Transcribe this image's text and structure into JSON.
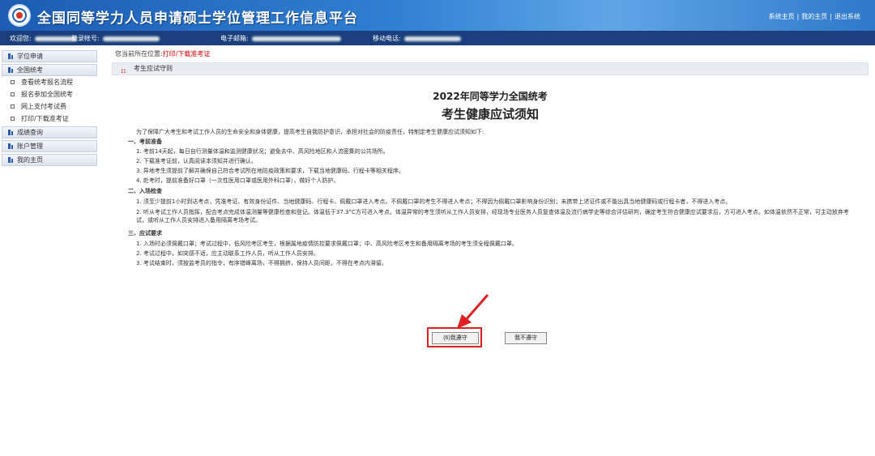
{
  "header": {
    "title": "全国同等学力人员申请硕士学位管理工作信息平台",
    "links": [
      "系统主页",
      "我的主页",
      "退出系统"
    ],
    "separator": "|"
  },
  "userbar": {
    "welcome_label": "欢迎您:",
    "account_label": "登录帐号:",
    "email_label": "电子邮箱:",
    "phone_label": "移动电话:"
  },
  "sidebar": {
    "sections": [
      {
        "label": "学位申请"
      },
      {
        "label": "全国统考",
        "items": [
          "查看统考报名流程",
          "报名参加全国统考",
          "网上支付考试费",
          "打印/下载准考证"
        ]
      },
      {
        "label": "成绩查询"
      },
      {
        "label": "账户管理"
      },
      {
        "label": "我的主页"
      }
    ]
  },
  "breadcrumb": {
    "prefix": "您当前所在位置:",
    "current": "打印/下载准考证"
  },
  "panel": {
    "dots_icon": "::",
    "title": "考生应试守则"
  },
  "document": {
    "subtitle": "2022年同等学力全国统考",
    "title": "考生健康应试须知",
    "intro": "为了保障广大考生和考试工作人员的生命安全和身体健康，提高考生自我防护意识，承担对社会的防疫责任，特制定考生健康应试须知如下:",
    "sections": [
      {
        "heading": "一、考前准备",
        "lines": [
          "1. 考前14天起，每日自行测量体温和监测健康状况；避免去中、高风险地区和人流密集的公共场所。",
          "2. 下载准考证前，认真阅读本须知并进行确认。",
          "3. 异地考生须提前了解并确保自己符合考试所在地防疫政策和要求，下载当地健康码、行程卡等相关程序。",
          "4. 赴考时，提前准备好口罩（一次性医用口罩或医用外科口罩），做好个人防护。"
        ]
      },
      {
        "heading": "二、入场检查",
        "lines": [
          "1. 须至少提前1小时到达考点，凭准考证、有效身份证件、当地健康码、行程卡、佩戴口罩进入考点。不佩戴口罩的考生不得进入考点；不得因为佩戴口罩影响身份识别；未携带上述证件或不能出具当地健康码或行程卡者，不得进入考点。",
          "2. 听从考试工作人员指挥，配合考点完成体温测量等健康检查和登记。体温低于37.3°C方可进入考点。体温异常的考生须听从工作人员安排，经现场专业医务人员复查体温及流行病学史等综合评估研判，确定考生符合健康应试要求后，方可进入考点。如体温依然不正常，可主动放弃考试，或听从工作人员安排进入备用隔离考场考试。"
        ]
      },
      {
        "heading": "三、应试要求",
        "lines": [
          "1. 入场时必须佩戴口罩；考试过程中，低风险考区考生，根据属地疫情防控要求佩戴口罩；中、高风险考区考生和备用隔离考场的考生须全程佩戴口罩。",
          "2. 考试过程中，如突感不适，应主动联系工作人员，听从工作人员安排。",
          "3. 考试结束时，须按监考员的指令，有序错峰离场，不得拥挤，保持人员间距，不得在考点内滞留。"
        ]
      }
    ]
  },
  "buttons": {
    "agree": "(6)我遵守",
    "disagree": "我不遵守"
  },
  "colors": {
    "header_blue": "#2f7fd3",
    "userbar_navy": "#1b3f7c",
    "highlight_red": "#e02020"
  }
}
